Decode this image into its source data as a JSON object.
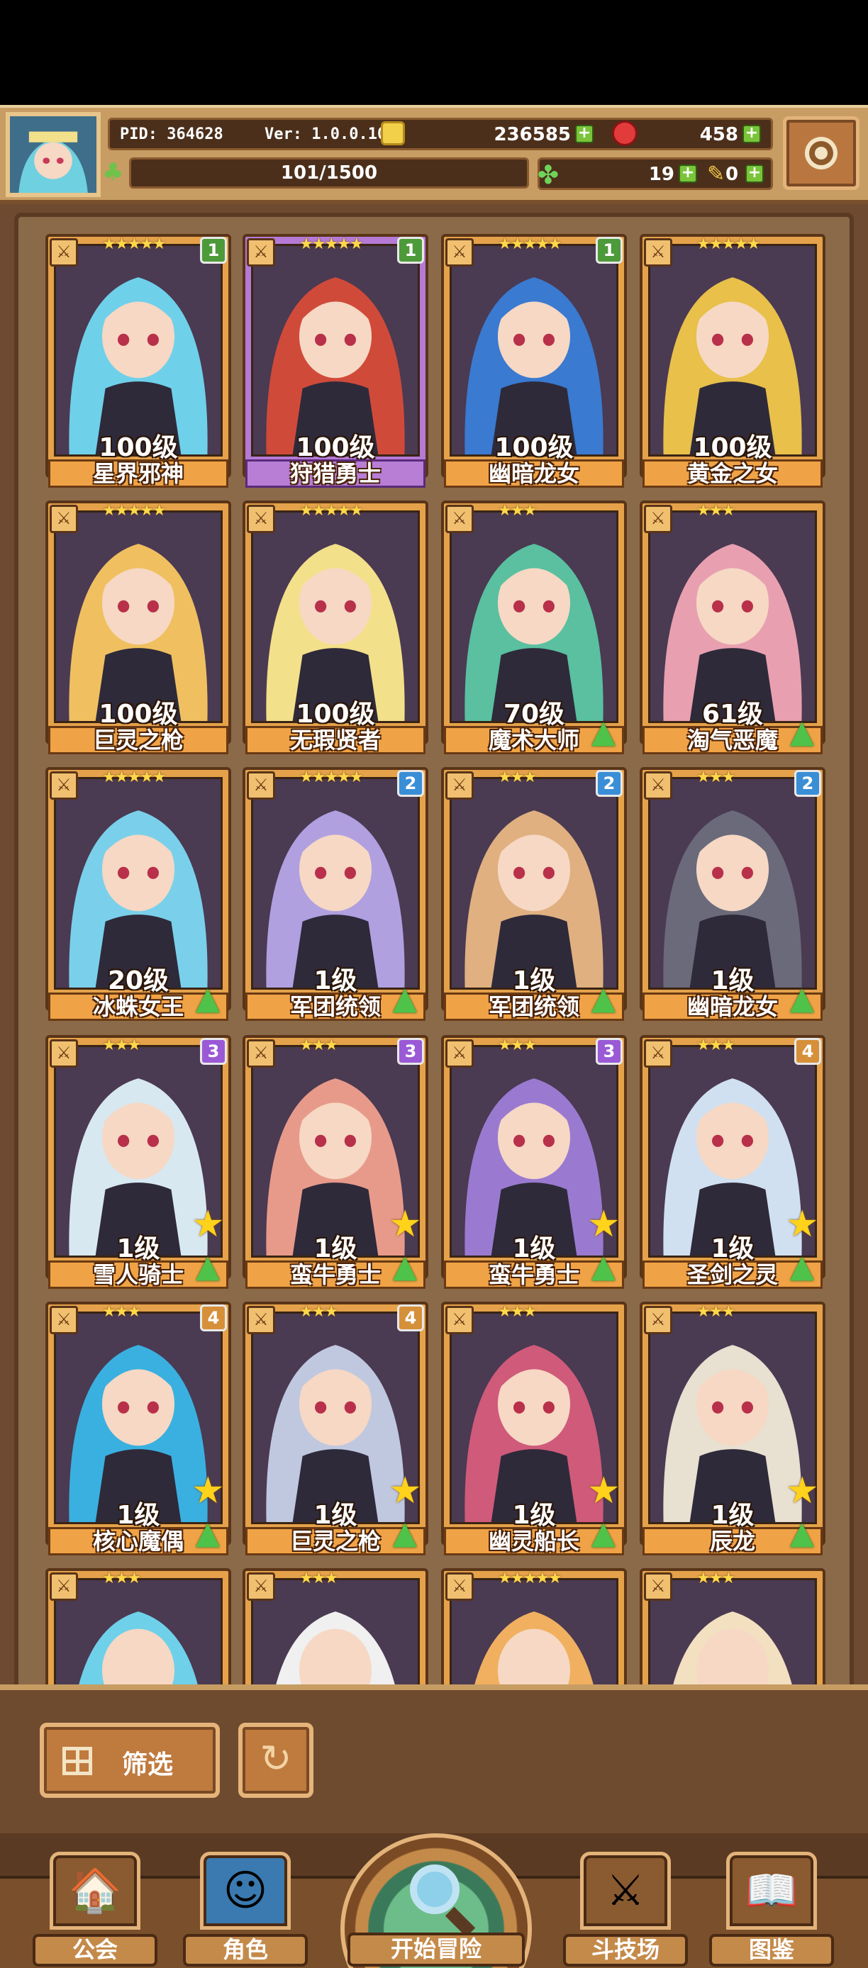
{
  "header": {
    "pid": "PID: 364628",
    "version": "Ver: 1.0.0.10",
    "gold": "236585",
    "gems": "458",
    "stamina": "101/1500",
    "clovers": "19",
    "keys": "0"
  },
  "heroes": [
    {
      "name": "星界邪神",
      "level": "100级",
      "badge": "1",
      "stars": "★★★★★"
    },
    {
      "name": "狩猎勇士",
      "level": "100级",
      "badge": "1",
      "stars": "★★★★★"
    },
    {
      "name": "幽暗龙女",
      "level": "100级",
      "badge": "1",
      "stars": "★★★★★"
    },
    {
      "name": "黄金之女",
      "level": "100级",
      "badge": "",
      "stars": "★★★★★"
    },
    {
      "name": "巨灵之枪",
      "level": "100级",
      "badge": "",
      "stars": "★★★★★"
    },
    {
      "name": "无瑕贤者",
      "level": "100级",
      "badge": "",
      "stars": "★★★★★"
    },
    {
      "name": "魔术大师",
      "level": "70级",
      "badge": "",
      "stars": "★★★"
    },
    {
      "name": "淘气恶魔",
      "level": "61级",
      "badge": "",
      "stars": "★★★"
    },
    {
      "name": "冰蛛女王",
      "level": "20级",
      "badge": "",
      "stars": "★★★★★"
    },
    {
      "name": "军团统领",
      "level": "1级",
      "badge": "2",
      "stars": "★★★★★"
    },
    {
      "name": "军团统领",
      "level": "1级",
      "badge": "2",
      "stars": "★★★"
    },
    {
      "name": "幽暗龙女",
      "level": "1级",
      "badge": "2",
      "stars": "★★★"
    },
    {
      "name": "雪人骑士",
      "level": "1级",
      "badge": "3",
      "stars": "★★★"
    },
    {
      "name": "蛮牛勇士",
      "level": "1级",
      "badge": "3",
      "stars": "★★★"
    },
    {
      "name": "蛮牛勇士",
      "level": "1级",
      "badge": "3",
      "stars": "★★★"
    },
    {
      "name": "圣剑之灵",
      "level": "1级",
      "badge": "4",
      "stars": "★★★"
    },
    {
      "name": "核心魔偶",
      "level": "1级",
      "badge": "4",
      "stars": "★★★"
    },
    {
      "name": "巨灵之枪",
      "level": "1级",
      "badge": "4",
      "stars": "★★★"
    },
    {
      "name": "幽灵船长",
      "level": "1级",
      "badge": "",
      "stars": "★★★"
    },
    {
      "name": "辰龙",
      "level": "1级",
      "badge": "",
      "stars": "★★★"
    }
  ],
  "partial_row_stars": [
    "★★★",
    "★★★",
    "★★★★★",
    "★★★"
  ],
  "controls": {
    "filter_label": "筛选",
    "refresh_symbol": "↻"
  },
  "nav": {
    "guild": "公会",
    "character": "角色",
    "adventure": "开始冒险",
    "arena": "斗技场",
    "codex": "图鉴"
  },
  "colors": {
    "card_gold": "#e5a24a",
    "card_purple": "#b67ad6",
    "upgrade_green": "#4fc24a",
    "star_yellow": "#ffd84a"
  }
}
